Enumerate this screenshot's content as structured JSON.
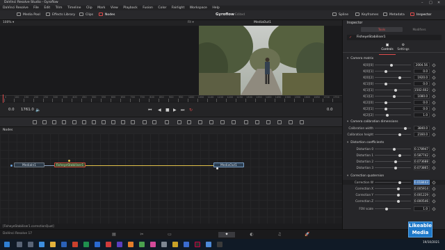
{
  "titlebar": {
    "title": "DaVinci Resolve Studio - Gyroflow"
  },
  "menu": [
    "DaVinci Resolve",
    "File",
    "Edit",
    "Trim",
    "Timeline",
    "Clip",
    "Mark",
    "View",
    "Playback",
    "Fusion",
    "Color",
    "Fairlight",
    "Workspace",
    "Help"
  ],
  "toolbar": {
    "media_pool": "Media Pool",
    "effects_library": "Effects Library",
    "clips": "Clips",
    "nodes": "Nodes",
    "project_name": "Gyroflow",
    "edited": "Edited",
    "spline": "Spline",
    "keyframes": "Keyframes",
    "metadata": "Metadata",
    "inspector": "Inspector"
  },
  "viewer": {
    "zoom": "100% ▾",
    "title": "MediaOut1",
    "timecode_start": "0.0",
    "timecode_end": "1761.0",
    "current_frame": "0.0",
    "ruler_labels": [
      "0",
      "100",
      "150",
      "200",
      "250",
      "300",
      "350",
      "400",
      "450",
      "500",
      "550",
      "600",
      "650",
      "700",
      "750",
      "800",
      "850",
      "900",
      "950",
      "1000",
      "1050",
      "1100",
      "1150",
      "1200",
      "1250",
      "1300",
      "1350",
      "1400",
      "1450",
      "1500",
      "1550",
      "1600",
      "1650",
      "1700",
      "1750"
    ]
  },
  "nodes_panel": {
    "title": "Nodes",
    "nodes": [
      "MediaIn1",
      "FisheyeStabiliser1",
      "MediaOut1"
    ]
  },
  "status_text": "[FisheyeStabiliser1.correctionQuat]",
  "inspector": {
    "title": "Inspector",
    "tab_tools": "Tools",
    "tab_modifiers": "Modifiers",
    "node_name": "FisheyeStabiliser1",
    "subtab_controls": "Controls",
    "subtab_settings": "Settings",
    "sections": {
      "camera_matrix": {
        "title": "Camera matrix",
        "rows": [
          {
            "label": "K[0][0]",
            "value": "2004.56"
          },
          {
            "label": "K[0][1]",
            "value": "0.0"
          },
          {
            "label": "K[0][2]",
            "value": "1920.0"
          },
          {
            "label": "K[1][0]",
            "value": "0.0"
          },
          {
            "label": "K[1][1]",
            "value": "1502.602"
          },
          {
            "label": "K[1][2]",
            "value": "1080.0"
          },
          {
            "label": "K[2][0]",
            "value": "0.0"
          },
          {
            "label": "K[2][1]",
            "value": "0.0"
          },
          {
            "label": "K[2][2]",
            "value": "1.0"
          }
        ]
      },
      "calibration": {
        "title": "Camera calibration dimensions",
        "rows": [
          {
            "label": "Calibration width",
            "value": "3840.0"
          },
          {
            "label": "Calibration height",
            "value": "2160.0"
          }
        ]
      },
      "distortion": {
        "title": "Distortion coefficients",
        "rows": [
          {
            "label": "Distortion 0",
            "value": "0.178947"
          },
          {
            "label": "Distortion 1",
            "value": "0.587742"
          },
          {
            "label": "Distortion 2",
            "value": "0.073688"
          },
          {
            "label": "Distortion 3",
            "value": "0.073865"
          }
        ]
      },
      "quaternion": {
        "title": "Correction quaternion",
        "rows": [
          {
            "label": "Correction W",
            "value": "0.018443"
          },
          {
            "label": "Correction X",
            "value": "0.005914"
          },
          {
            "label": "Correction Y",
            "value": "0.001229"
          },
          {
            "label": "Correction Z",
            "value": "0.000546"
          }
        ]
      },
      "fov": {
        "label": "FOV scale",
        "value": "1.0"
      }
    }
  },
  "pagebar": {
    "app_name": "DaVinci Resolve 17"
  },
  "taskbar": {
    "time": "",
    "date": "19/10/2021"
  },
  "watermark": {
    "line1": "Likeable",
    "line2": "Media"
  },
  "colors": {
    "accent": "#e24d4d",
    "node_wire": "#e3c24a",
    "value_highlight": "#3d6ea8"
  }
}
